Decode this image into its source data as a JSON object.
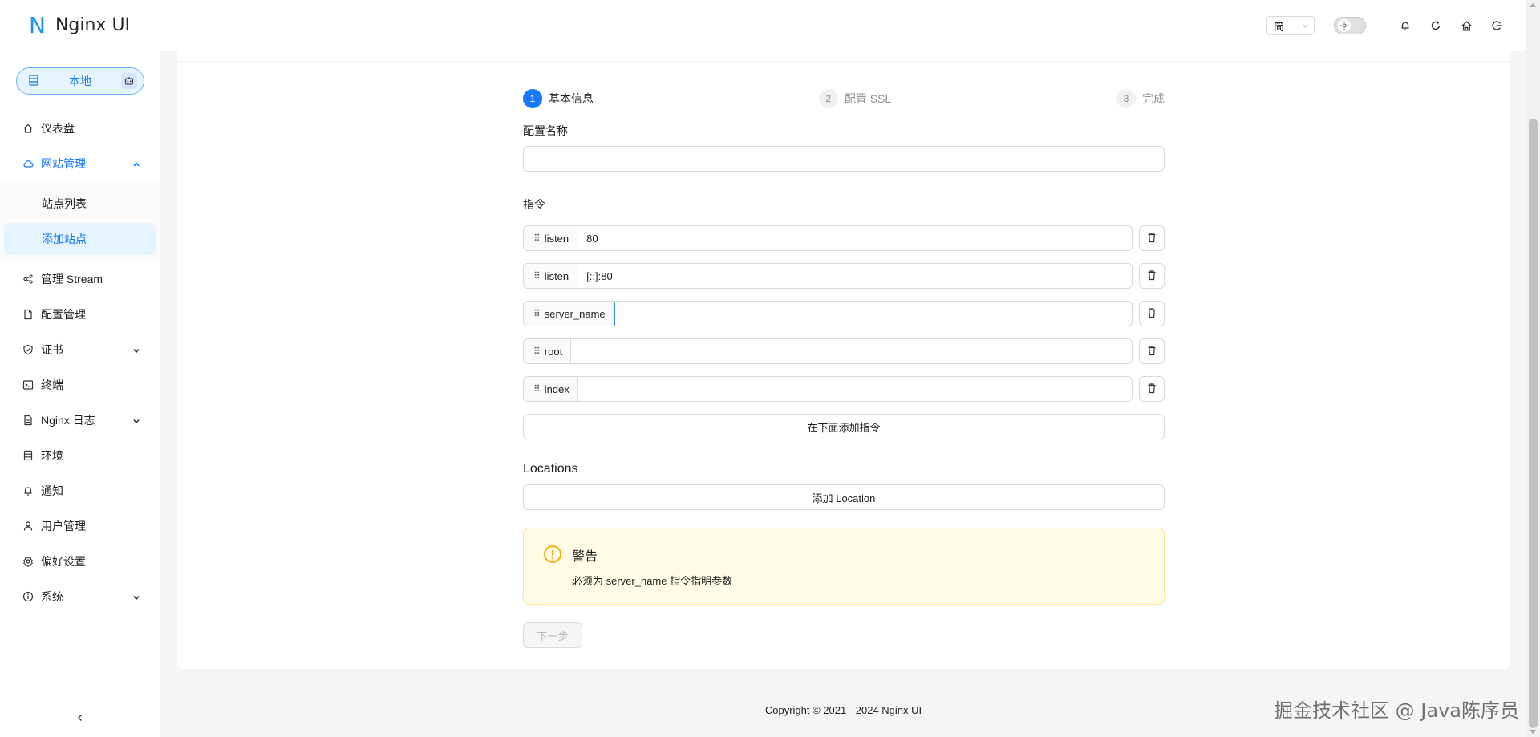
{
  "app": {
    "logo_letter": "N",
    "name": "Nginx UI"
  },
  "env": {
    "label": "本地"
  },
  "sidebar": {
    "items": [
      {
        "label": "仪表盘",
        "icon": "home-icon"
      },
      {
        "label": "网站管理",
        "icon": "cloud-icon",
        "expanded": true,
        "children": [
          {
            "label": "站点列表"
          },
          {
            "label": "添加站点",
            "active": true
          }
        ]
      },
      {
        "label": "管理 Stream",
        "icon": "share-icon"
      },
      {
        "label": "配置管理",
        "icon": "file-icon"
      },
      {
        "label": "证书",
        "icon": "shield-icon",
        "has_children": true
      },
      {
        "label": "终端",
        "icon": "terminal-icon"
      },
      {
        "label": "Nginx 日志",
        "icon": "file-text-icon",
        "has_children": true
      },
      {
        "label": "环境",
        "icon": "database-icon"
      },
      {
        "label": "通知",
        "icon": "bell-icon"
      },
      {
        "label": "用户管理",
        "icon": "user-icon"
      },
      {
        "label": "偏好设置",
        "icon": "settings-icon"
      },
      {
        "label": "系统",
        "icon": "info-icon",
        "has_children": true
      }
    ]
  },
  "header": {
    "language": "简"
  },
  "steps": [
    {
      "num": "1",
      "label": "基本信息",
      "status": "active"
    },
    {
      "num": "2",
      "label": "配置 SSL",
      "status": "wait"
    },
    {
      "num": "3",
      "label": "完成",
      "status": "wait"
    }
  ],
  "form": {
    "config_name_label": "配置名称",
    "config_name_value": "",
    "directives_label": "指令",
    "directives": [
      {
        "name": "listen",
        "value": "80"
      },
      {
        "name": "listen",
        "value": "[::]:80"
      },
      {
        "name": "server_name",
        "value": ""
      },
      {
        "name": "root",
        "value": ""
      },
      {
        "name": "index",
        "value": ""
      }
    ],
    "add_directive_label": "在下面添加指令",
    "locations_label": "Locations",
    "add_location_label": "添加 Location"
  },
  "alert": {
    "title": "警告",
    "message": "必须为 server_name 指令指明参数"
  },
  "next_button": "下一步",
  "footer": "Copyright © 2021 - 2024 Nginx UI",
  "watermark": "掘金技术社区 @ Java陈序员",
  "colors": {
    "primary": "#1677ff",
    "warning": "#faad14",
    "warning_bg": "#fffbe6"
  }
}
